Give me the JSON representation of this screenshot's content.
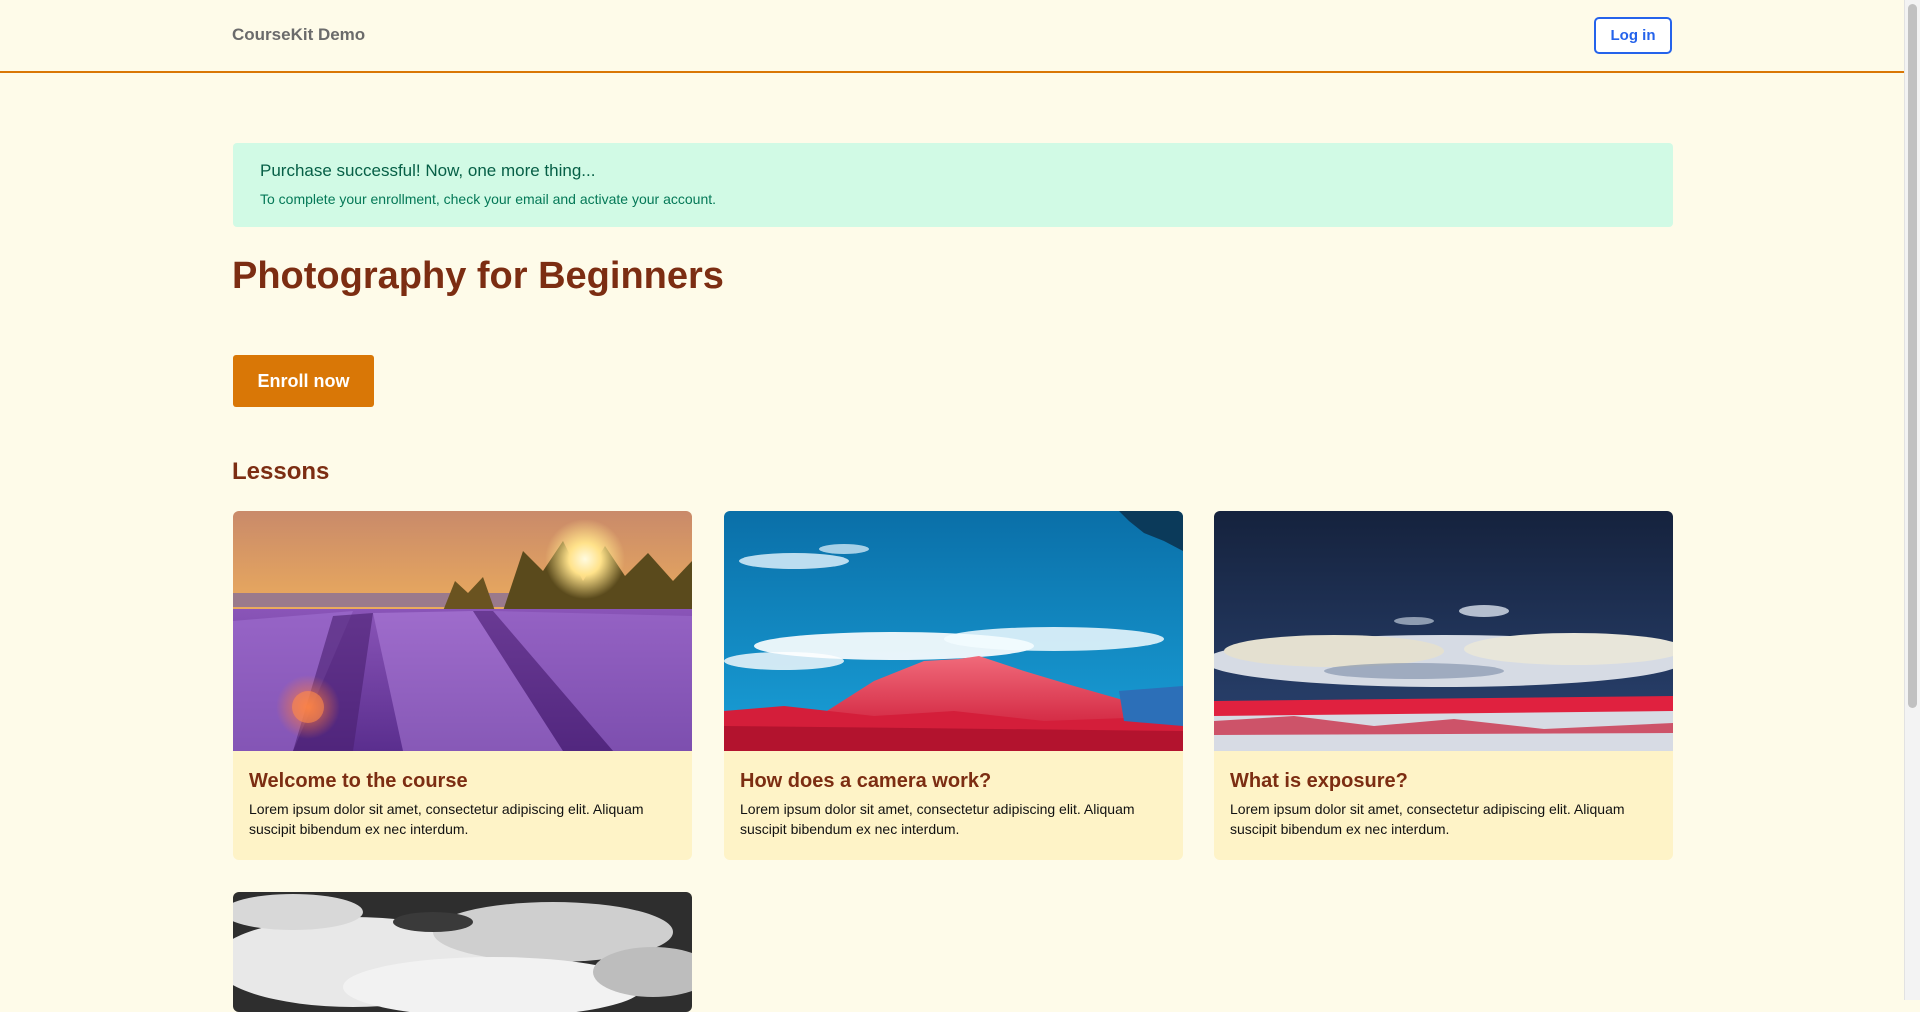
{
  "header": {
    "brand": "CourseKit Demo",
    "login_label": "Log in"
  },
  "alert": {
    "title": "Purchase successful! Now, one more thing...",
    "body": "To complete your enrollment, check your email and activate your account."
  },
  "course": {
    "title": "Photography for Beginners",
    "enroll_label": "Enroll now"
  },
  "lessons": {
    "heading": "Lessons",
    "items": [
      {
        "title": "Welcome to the course",
        "description": "Lorem ipsum dolor sit amet, consectetur adipiscing elit. Aliquam suscipit bibendum ex nec interdum."
      },
      {
        "title": "How does a camera work?",
        "description": "Lorem ipsum dolor sit amet, consectetur adipiscing elit. Aliquam suscipit bibendum ex nec interdum."
      },
      {
        "title": "What is exposure?",
        "description": "Lorem ipsum dolor sit amet, consectetur adipiscing elit. Aliquam suscipit bibendum ex nec interdum."
      }
    ]
  },
  "colors": {
    "page_bg": "#fefbe9",
    "accent": "#d97706",
    "heading": "#7c2d12",
    "link": "#2563eb",
    "success_bg": "#d1fae5",
    "card_bg": "#fef3c7"
  }
}
